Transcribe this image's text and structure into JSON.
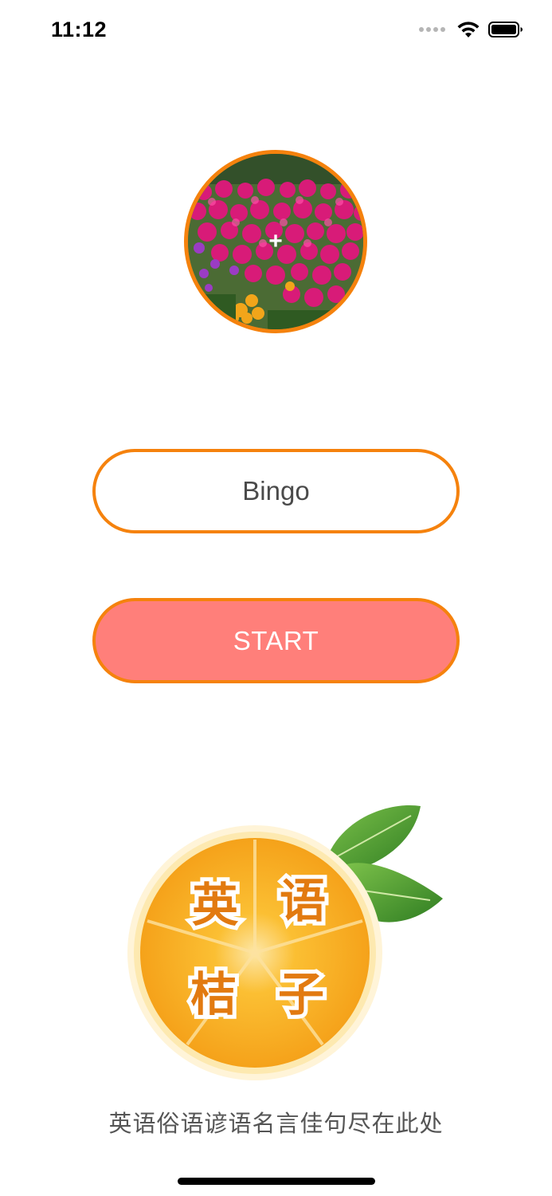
{
  "status_bar": {
    "time": "11:12",
    "wifi_icon": "wifi-icon",
    "battery_icon": "battery-icon"
  },
  "avatar": {
    "add_symbol": "+",
    "icon": "plus-icon",
    "border_color": "#f5820d"
  },
  "name_field": {
    "value": "Bingo"
  },
  "start_button": {
    "label": "START",
    "background": "#ff7f7a",
    "border_color": "#f5820d"
  },
  "logo": {
    "characters": [
      "英",
      "语",
      "桔",
      "子"
    ]
  },
  "slogan": "英语俗语谚语名言佳句尽在此处"
}
